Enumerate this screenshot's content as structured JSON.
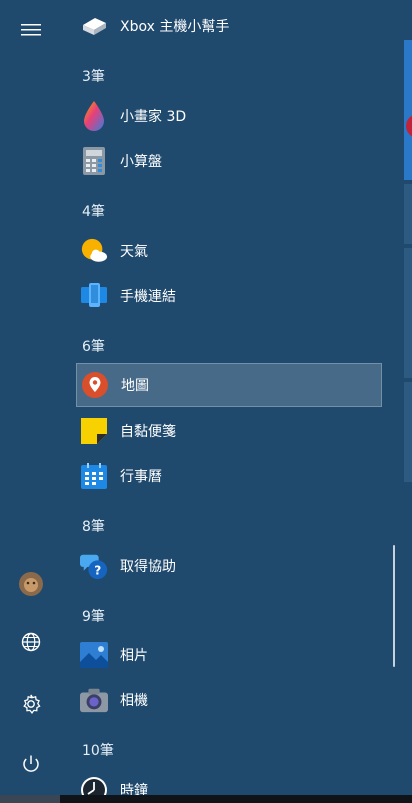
{
  "rail": {
    "menu_icon": "hamburger-menu-icon",
    "avatar_icon": "user-avatar",
    "network_icon": "globe-icon",
    "settings_icon": "gear-icon",
    "power_icon": "power-icon"
  },
  "list": {
    "items": [
      {
        "label": "Xbox 主機小幫手",
        "icon": "xbox-console-icon"
      },
      {
        "label": "小畫家 3D",
        "icon": "paint-3d-icon"
      },
      {
        "label": "小算盤",
        "icon": "calculator-icon"
      },
      {
        "label": "天氣",
        "icon": "weather-icon"
      },
      {
        "label": "手機連結",
        "icon": "phone-link-icon"
      },
      {
        "label": "地圖",
        "icon": "maps-icon"
      },
      {
        "label": "自黏便箋",
        "icon": "sticky-notes-icon"
      },
      {
        "label": "行事曆",
        "icon": "calendar-icon"
      },
      {
        "label": "取得協助",
        "icon": "get-help-icon"
      },
      {
        "label": "相片",
        "icon": "photos-icon"
      },
      {
        "label": "相機",
        "icon": "camera-icon"
      },
      {
        "label": "時鐘",
        "icon": "clock-icon"
      }
    ],
    "headers": [
      "3筆",
      "4筆",
      "6筆",
      "8筆",
      "9筆",
      "10筆"
    ]
  },
  "colors": {
    "background": "#1f4a6e",
    "accent": "#0078d7"
  }
}
